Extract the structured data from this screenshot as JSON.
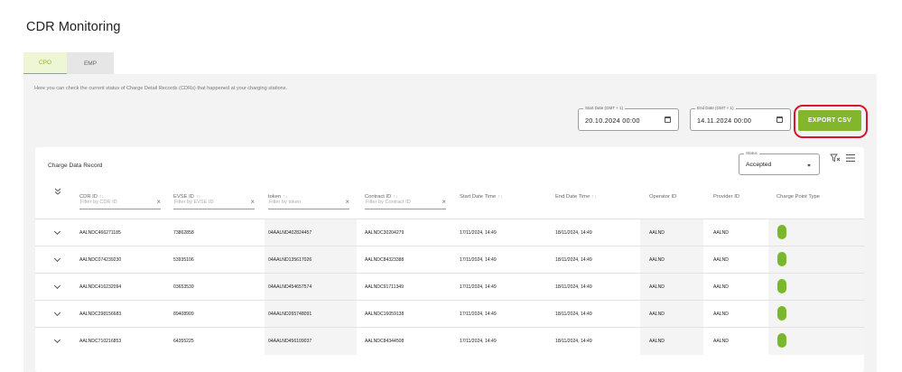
{
  "page_title": "CDR Monitoring",
  "tabs": [
    {
      "label": "CPO",
      "active": true
    },
    {
      "label": "EMP",
      "active": false
    }
  ],
  "intro_text": "Here you can check the current status of Charge Detail Records (CDRs) that happened at your charging stations.",
  "start_date": {
    "label": "Start Date (GMT + 1)",
    "value": "20.10.2024 00:00",
    "icon": "calendar-icon"
  },
  "end_date": {
    "label": "End Date (GMT + 1)",
    "value": "14.11.2024 00:00",
    "icon": "calendar-icon"
  },
  "export_button": {
    "label": "EXPORT CSV",
    "color": "#84b62d",
    "highlight_color": "#d6162c"
  },
  "card": {
    "title": "Charge Data Record",
    "status": {
      "label": "Status",
      "value": "Accepted"
    },
    "icons": [
      "clear-filters-icon",
      "columns-menu-icon"
    ]
  },
  "columns": [
    {
      "label": "CDR ID",
      "sortable": true,
      "filter_placeholder": "Filter by CDR ID"
    },
    {
      "label": "EVSE ID",
      "sortable": true,
      "filter_placeholder": "Filter by EVSE ID"
    },
    {
      "label": "token",
      "sortable": true,
      "filter_placeholder": "Filter by token"
    },
    {
      "label": "Contract ID",
      "sortable": true,
      "filter_placeholder": "Filter by Contract ID"
    },
    {
      "label": "Start Date Time",
      "sortable": true
    },
    {
      "label": "End Date Time",
      "sortable": true
    },
    {
      "label": "Operator ID",
      "sortable": false
    },
    {
      "label": "Provider ID",
      "sortable": false
    },
    {
      "label": "Charge Point Type",
      "sortable": false
    }
  ],
  "rows": [
    {
      "cdr_id": "AALNDC466271185",
      "evse_id": "73862858",
      "token": "04AALND402824457",
      "contract_id": "AALNDC30204279",
      "start": "17/11/2024, 14:49",
      "end": "18/11/2024, 14:49",
      "operator_id": "AALND",
      "provider_id": "AALND"
    },
    {
      "cdr_id": "AALNDC074239230",
      "evse_id": "53935106",
      "token": "04AALND135617026",
      "contract_id": "AALNDC84323388",
      "start": "17/11/2024, 14:49",
      "end": "18/11/2024, 14:49",
      "operator_id": "AALND",
      "provider_id": "AALND"
    },
    {
      "cdr_id": "AALNDC416232094",
      "evse_id": "03653539",
      "token": "04AALND454657574",
      "contract_id": "AALNDC91711349",
      "start": "17/11/2024, 14:49",
      "end": "18/11/2024, 14:49",
      "operator_id": "AALND",
      "provider_id": "AALND"
    },
    {
      "cdr_id": "AALNDC298156683",
      "evse_id": "89408909",
      "token": "04AALND265748091",
      "contract_id": "AALNDC16059138",
      "start": "17/11/2024, 14:49",
      "end": "18/11/2024, 14:49",
      "operator_id": "AALND",
      "provider_id": "AALND"
    },
    {
      "cdr_id": "AALNDC710216853",
      "evse_id": "64355225",
      "token": "04AALND456109037",
      "contract_id": "AALNDC84344508",
      "start": "17/11/2024, 14:49",
      "end": "18/11/2024, 14:49",
      "operator_id": "AALND",
      "provider_id": "AALND"
    }
  ],
  "charge_point_color": "#79b72b"
}
